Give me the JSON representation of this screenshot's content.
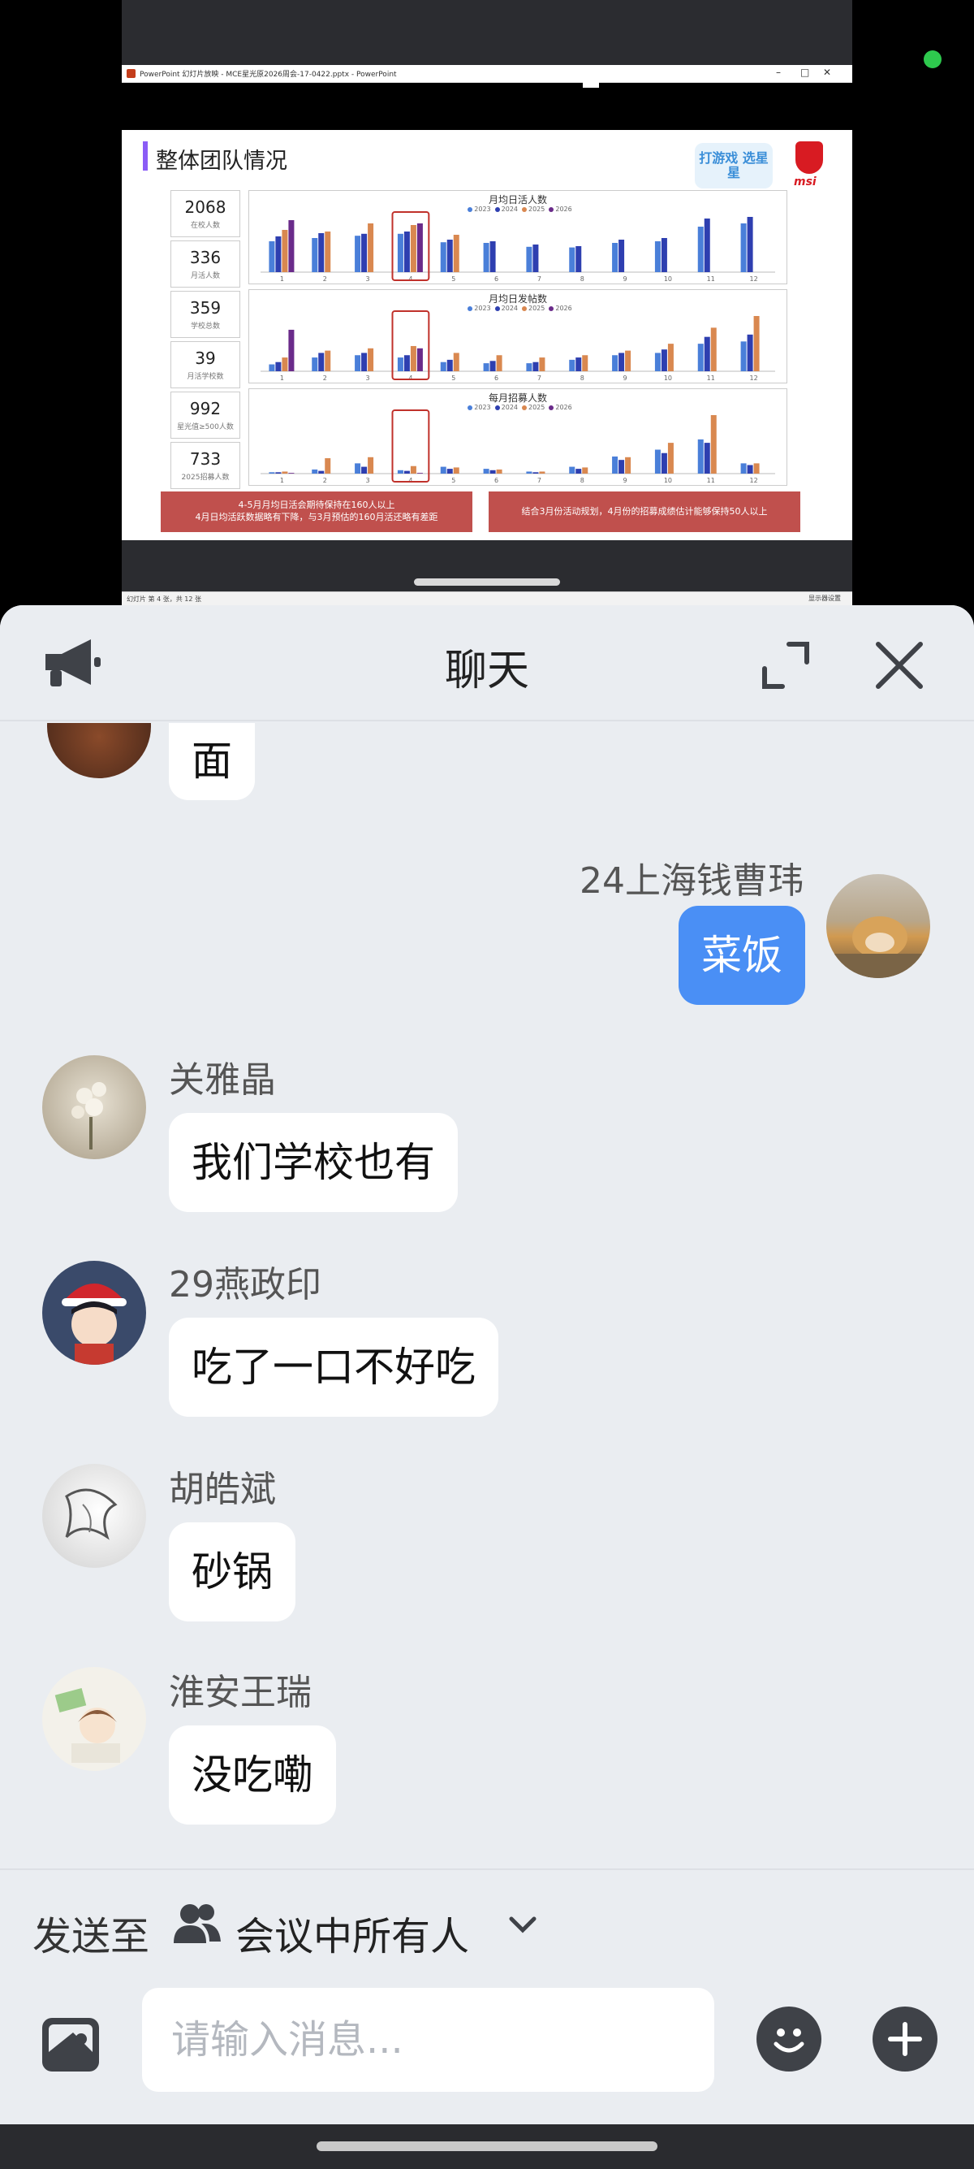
{
  "ppt": {
    "window_title": "PowerPoint 幻灯片放映 - MCE星光原2026周会-17-0422.pptx - PowerPoint",
    "win_minimize": "–",
    "win_restore": "□",
    "win_close": "✕",
    "status_left": "幻灯片 第 4 张，共 12 张",
    "status_right": "显示器设置"
  },
  "slide": {
    "title": "整体团队情况",
    "badge_text": "打游戏 选星星",
    "brand": "msi",
    "kpis": [
      {
        "value": "2068",
        "label": "在校人数"
      },
      {
        "value": "336",
        "label": "月活人数"
      },
      {
        "value": "359",
        "label": "学校总数"
      },
      {
        "value": "39",
        "label": "月活学校数"
      },
      {
        "value": "992",
        "label": "星光值≥500人数"
      },
      {
        "value": "733",
        "label": "2025招募人数"
      }
    ],
    "box_left_line1": "4-5月月均日活会期待保持在160人以上",
    "box_left_line2": "4月日均活跃数据略有下降，与3月预估的160月活还略有差距",
    "box_right": "结合3月份活动规划，4月份的招募成绩估计能够保持50人以上"
  },
  "chart_data": [
    {
      "type": "bar",
      "title": "月均日活人数",
      "categories": [
        "1",
        "2",
        "3",
        "4",
        "5",
        "6",
        "7",
        "8",
        "9",
        "10",
        "11",
        "12"
      ],
      "highlight_category": "4",
      "series": [
        {
          "name": "2023",
          "color": "#4a7fd9",
          "values": [
            95,
            105,
            112,
            118,
            92,
            90,
            78,
            76,
            90,
            95,
            140,
            150
          ]
        },
        {
          "name": "2024",
          "color": "#2e3fb0",
          "values": [
            110,
            120,
            118,
            125,
            100,
            95,
            85,
            80,
            100,
            105,
            165,
            170
          ]
        },
        {
          "name": "2025",
          "color": "#d98850",
          "values": [
            130,
            125,
            150,
            145,
            115,
            0,
            0,
            0,
            0,
            0,
            0,
            0
          ]
        },
        {
          "name": "2026",
          "color": "#6a2b8a",
          "values": [
            160,
            0,
            0,
            150,
            0,
            0,
            0,
            0,
            0,
            0,
            0,
            0
          ]
        }
      ]
    },
    {
      "type": "bar",
      "title": "月均日发帖数",
      "categories": [
        "1",
        "2",
        "3",
        "4",
        "5",
        "6",
        "7",
        "8",
        "9",
        "10",
        "11",
        "12"
      ],
      "highlight_category": "4",
      "series": [
        {
          "name": "2023",
          "color": "#4a7fd9",
          "values": [
            30,
            60,
            70,
            60,
            40,
            35,
            35,
            50,
            70,
            80,
            120,
            130
          ]
        },
        {
          "name": "2024",
          "color": "#2e3fb0",
          "values": [
            40,
            80,
            80,
            70,
            50,
            45,
            40,
            60,
            80,
            95,
            150,
            160
          ]
        },
        {
          "name": "2025",
          "color": "#d98850",
          "values": [
            60,
            90,
            100,
            110,
            80,
            70,
            60,
            70,
            90,
            120,
            190,
            241
          ]
        },
        {
          "name": "2026",
          "color": "#6a2b8a",
          "values": [
            181,
            0,
            0,
            100,
            0,
            0,
            0,
            0,
            0,
            0,
            0,
            0
          ]
        }
      ]
    },
    {
      "type": "bar",
      "title": "每月招募人数",
      "categories": [
        "1",
        "2",
        "3",
        "4",
        "5",
        "6",
        "7",
        "8",
        "9",
        "10",
        "11",
        "12"
      ],
      "highlight_category": "4",
      "series": [
        {
          "name": "2023",
          "color": "#4a7fd9",
          "values": [
            4,
            12,
            30,
            10,
            20,
            14,
            6,
            20,
            50,
            70,
            100,
            30
          ]
        },
        {
          "name": "2024",
          "color": "#2e3fb0",
          "values": [
            4,
            8,
            20,
            8,
            14,
            10,
            4,
            14,
            40,
            60,
            90,
            25
          ]
        },
        {
          "name": "2025",
          "color": "#d98850",
          "values": [
            6,
            45,
            48,
            22,
            18,
            12,
            6,
            18,
            48,
            90,
            171,
            30
          ]
        },
        {
          "name": "2026",
          "color": "#6a2b8a",
          "values": [
            2,
            0,
            0,
            2,
            0,
            0,
            0,
            0,
            0,
            0,
            0,
            0
          ]
        }
      ]
    }
  ],
  "chat": {
    "title": "聊天",
    "messages": [
      {
        "sender": "",
        "text": "面",
        "self": false,
        "avatar": "avatar-bird"
      },
      {
        "sender": "24上海钱曹玮",
        "text": "菜饭",
        "self": true,
        "avatar": "avatar-doge"
      },
      {
        "sender": "关雅晶",
        "text": "我们学校也有",
        "self": false,
        "avatar": "avatar-flowers"
      },
      {
        "sender": "29燕政印",
        "text": "吃了一口不好吃",
        "self": false,
        "avatar": "avatar-cartoon-santa"
      },
      {
        "sender": "胡皓斌",
        "text": "砂锅",
        "self": false,
        "avatar": "avatar-sketch"
      },
      {
        "sender": "淮安王瑞",
        "text": "没吃嘞",
        "self": false,
        "avatar": "avatar-cartoon-girl"
      }
    ],
    "send_to_label": "发送至",
    "send_to_value": "会议中所有人",
    "input_placeholder": "请输入消息...",
    "input_value": ""
  },
  "colors": {
    "accent_blue": "#4a8ff5",
    "chat_bg": "#eaedf1",
    "slide_red": "#c0504d",
    "share_dot_green": "#2ec94e"
  }
}
